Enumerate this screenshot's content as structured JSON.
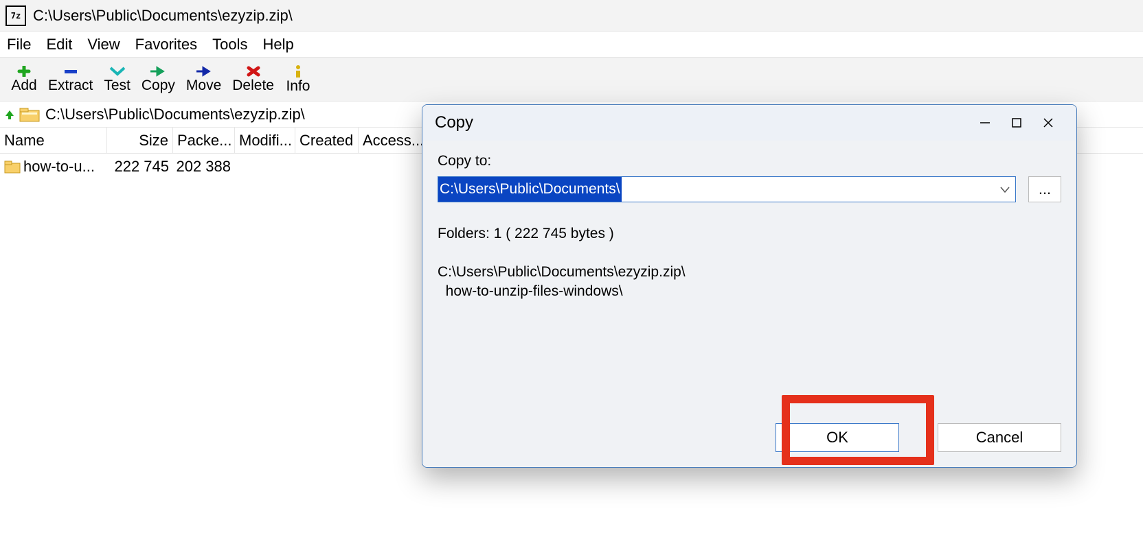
{
  "titlebar": {
    "path": "C:\\Users\\Public\\Documents\\ezyzip.zip\\"
  },
  "menu": {
    "file": "File",
    "edit": "Edit",
    "view": "View",
    "favorites": "Favorites",
    "tools": "Tools",
    "help": "Help"
  },
  "toolbar": {
    "add": "Add",
    "extract": "Extract",
    "test": "Test",
    "copy": "Copy",
    "move": "Move",
    "delete": "Delete",
    "info": "Info"
  },
  "addressbar": {
    "path": "C:\\Users\\Public\\Documents\\ezyzip.zip\\"
  },
  "columns": {
    "name": "Name",
    "size": "Size",
    "packed": "Packe...",
    "modified": "Modifi...",
    "created": "Created",
    "accessed": "Access..."
  },
  "rows": [
    {
      "name": "how-to-u...",
      "size": "222 745",
      "packed": "202 388"
    }
  ],
  "dialog": {
    "title": "Copy",
    "copy_to_label": "Copy to:",
    "path_value": "C:\\Users\\Public\\Documents\\",
    "browse": "...",
    "info": "Folders: 1    ( 222 745 bytes )",
    "src_line1": "C:\\Users\\Public\\Documents\\ezyzip.zip\\",
    "src_line2": "  how-to-unzip-files-windows\\",
    "ok": "OK",
    "cancel": "Cancel"
  }
}
